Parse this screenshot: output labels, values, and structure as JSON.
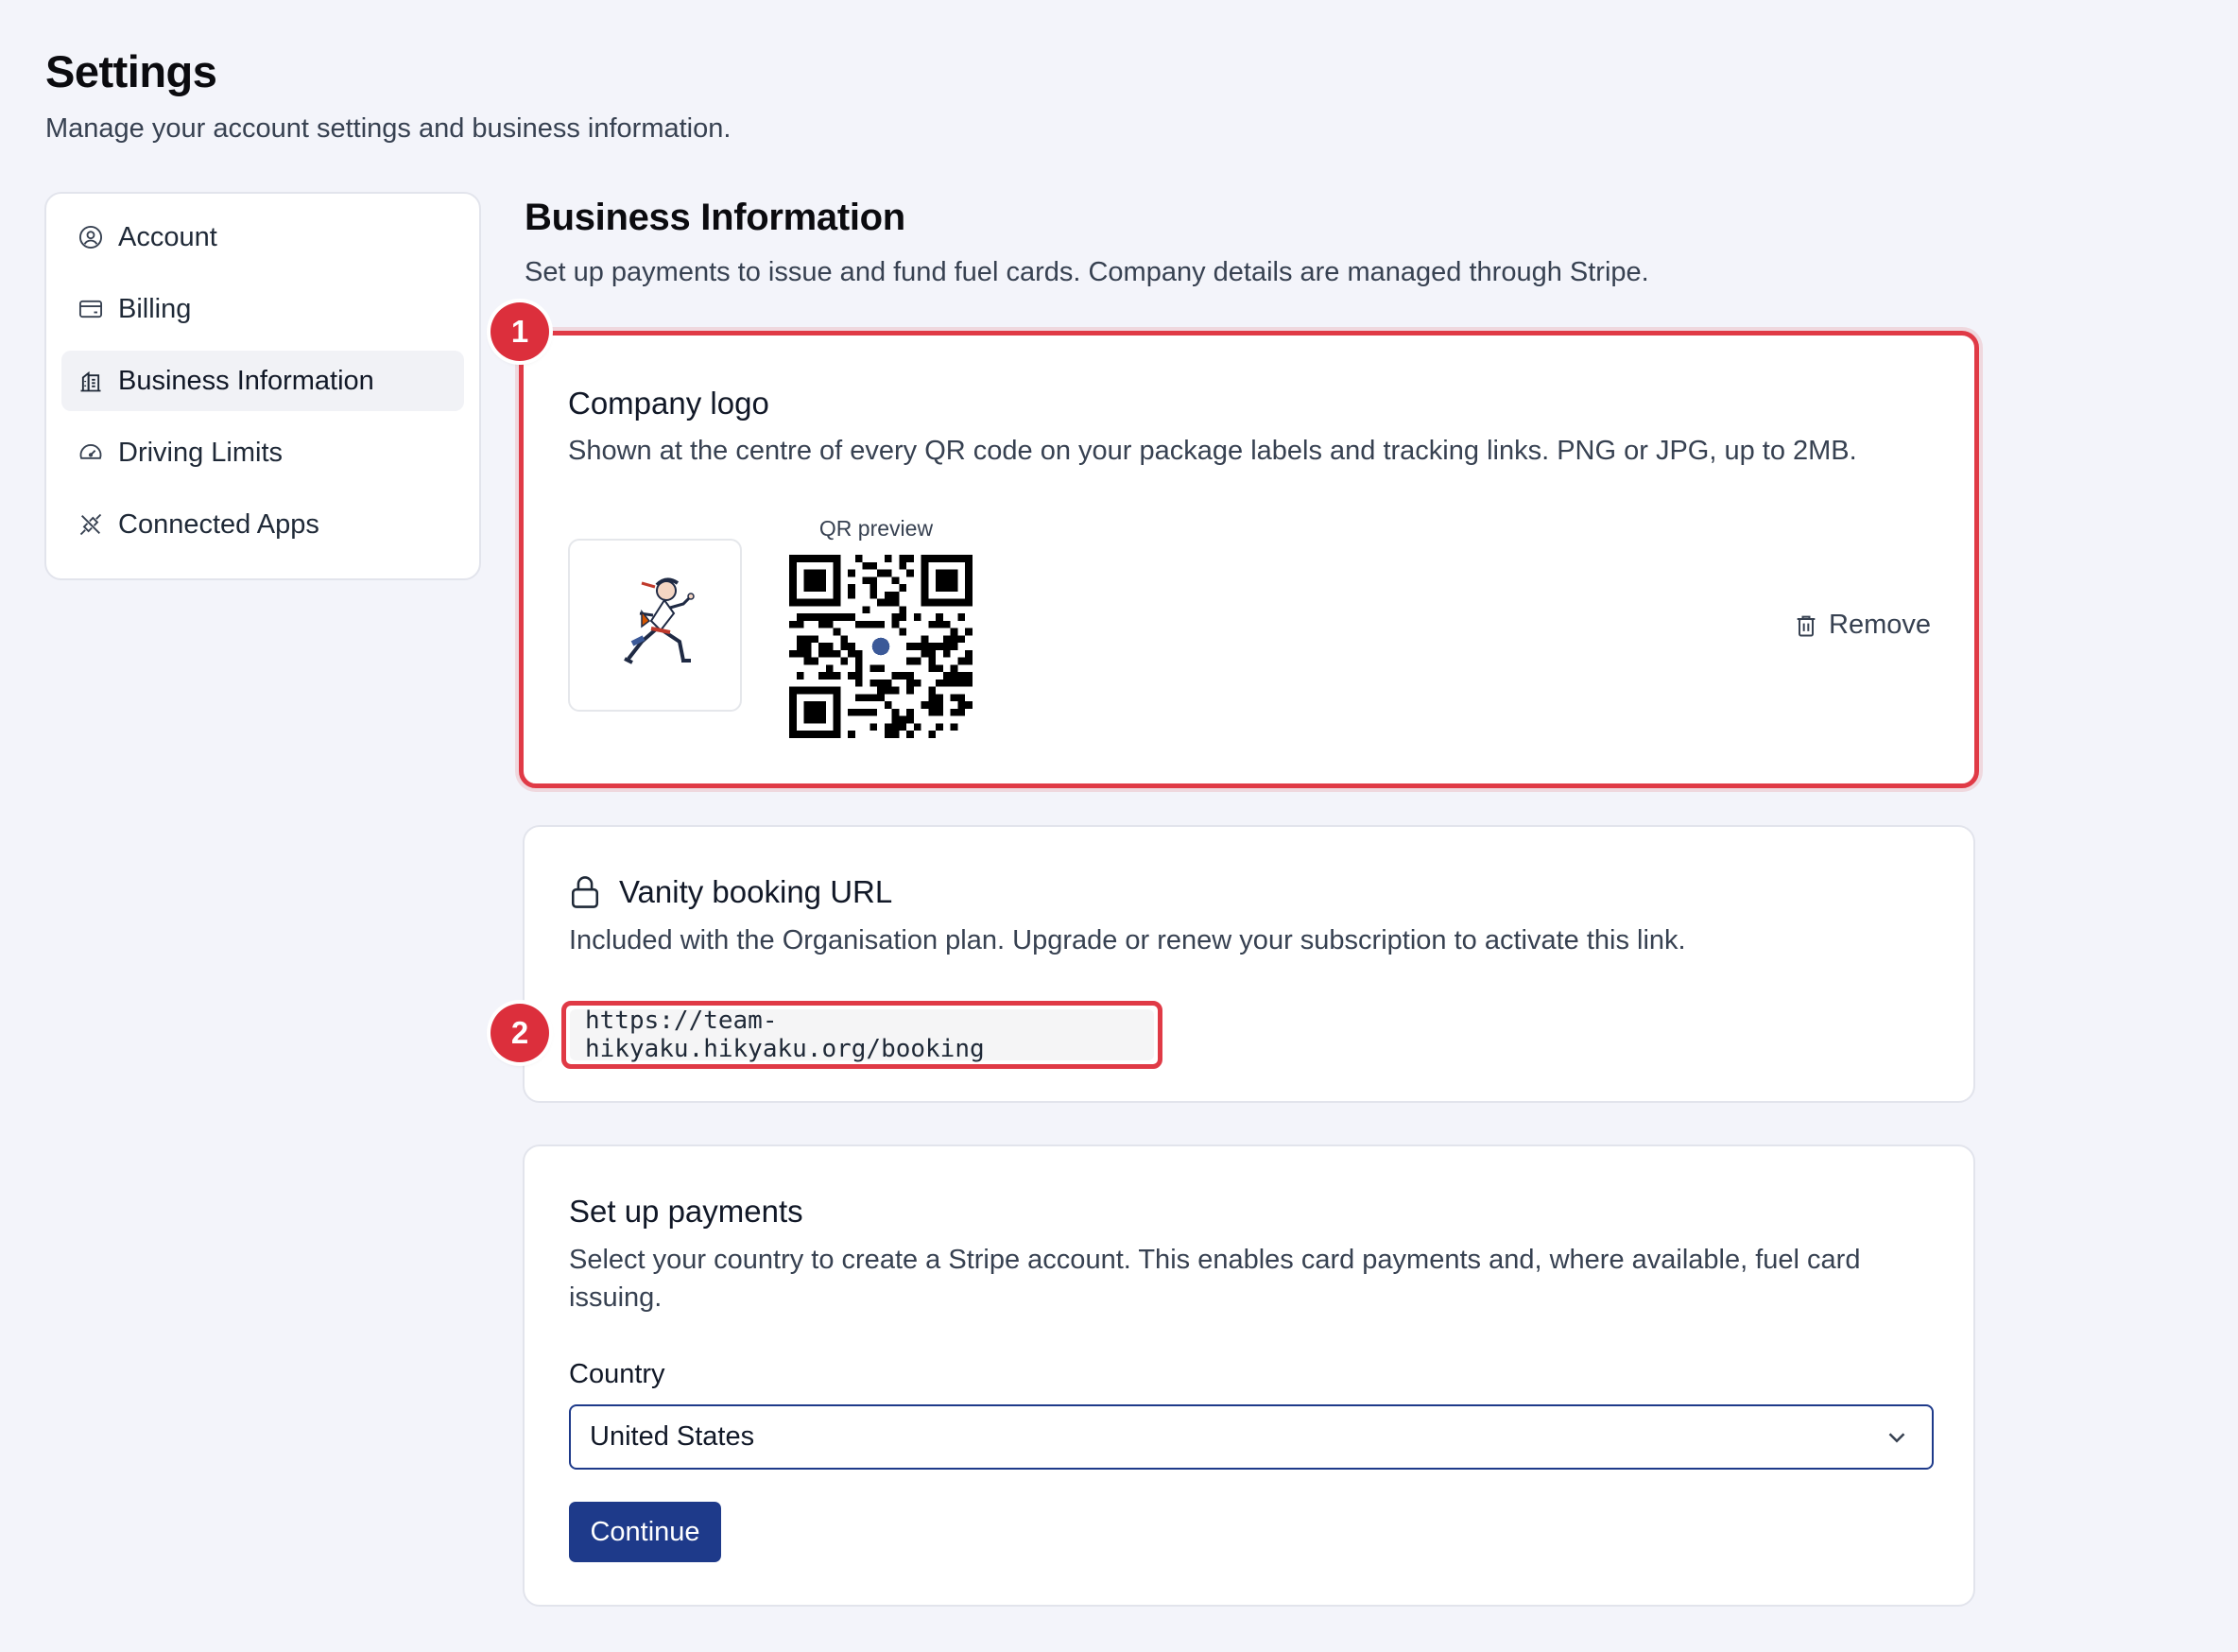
{
  "page": {
    "title": "Settings",
    "subtitle": "Manage your account settings and business information."
  },
  "sidebar": {
    "items": [
      {
        "label": "Account",
        "icon": "user-circle-icon"
      },
      {
        "label": "Billing",
        "icon": "credit-card-icon"
      },
      {
        "label": "Business Information",
        "icon": "building-icon",
        "active": true
      },
      {
        "label": "Driving Limits",
        "icon": "gauge-icon"
      },
      {
        "label": "Connected Apps",
        "icon": "plug-icon"
      }
    ]
  },
  "section": {
    "title": "Business Information",
    "subtitle": "Set up payments to issue and fund fuel cards. Company details are managed through Stripe."
  },
  "logo_card": {
    "badge": "1",
    "title": "Company logo",
    "description": "Shown at the centre of every QR code on your package labels and tracking links. PNG or JPG, up to 2MB.",
    "qr_label": "QR preview",
    "remove_label": "Remove"
  },
  "vanity_card": {
    "badge": "2",
    "title": "Vanity booking URL",
    "description": "Included with the Organisation plan. Upgrade or renew your subscription to activate this link.",
    "url": "https://team-hikyaku.hikyaku.org/booking"
  },
  "payments_card": {
    "title": "Set up payments",
    "description": "Select your country to create a Stripe account. This enables card payments and, where available, fuel card issuing.",
    "country_label": "Country",
    "country_value": "United States",
    "continue_label": "Continue"
  },
  "colors": {
    "accent": "#1e3a8a",
    "highlight": "#e03a46",
    "background": "#f3f4fa"
  }
}
